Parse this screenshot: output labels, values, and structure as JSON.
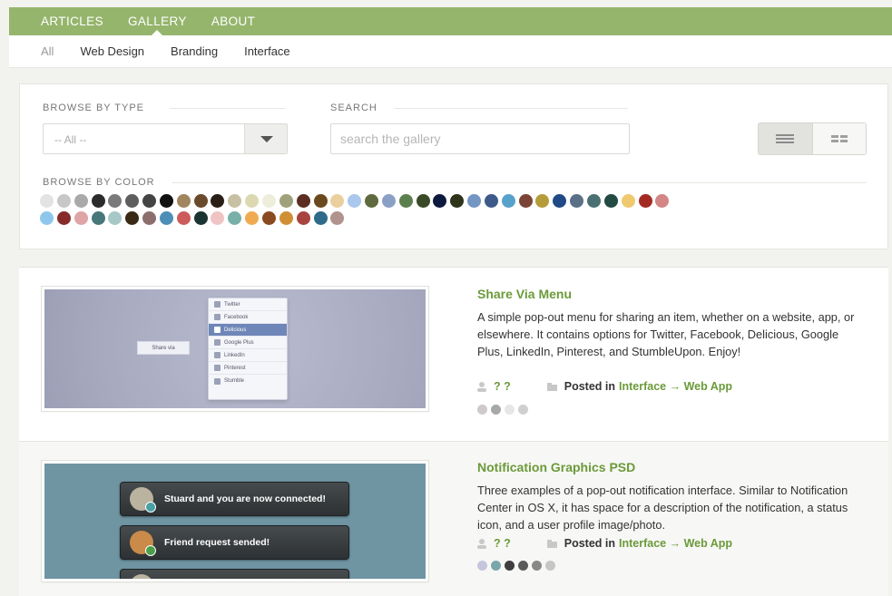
{
  "nav": {
    "items": [
      {
        "label": "ARTICLES"
      },
      {
        "label": "GALLERY"
      },
      {
        "label": "ABOUT"
      }
    ],
    "active": "GALLERY"
  },
  "subnav": {
    "items": [
      {
        "label": "All"
      },
      {
        "label": "Web Design"
      },
      {
        "label": "Branding"
      },
      {
        "label": "Interface"
      }
    ]
  },
  "filters": {
    "browse_type_label": "BROWSE BY TYPE",
    "type_selected": "-- All --",
    "search_label": "SEARCH",
    "search_placeholder": "search the gallery",
    "browse_color_label": "BROWSE BY COLOR",
    "colors_row1": [
      "#e3e3e3",
      "#c7c7c7",
      "#a9a9a9",
      "#2b2b2b",
      "#7a7a7a",
      "#5e5e5e",
      "#444444",
      "#111111",
      "#a0855f",
      "#6b4a2c",
      "#2a1f17",
      "#c8c0a4",
      "#dcd9b2",
      "#eceedb",
      "#9ea17c",
      "#5c2e23",
      "#6a4a1d",
      "#ebcf9d",
      "#aac7ec",
      "#5f6b3e",
      "#8ba0c5",
      "#5b7f4e",
      "#3a4a26",
      "#0d1a3f",
      "#2e341a",
      "#7396c3",
      "#3e5a8a",
      "#57a2cb",
      "#7a4437",
      "#b49c3a",
      "#1f4a86",
      "#5a7086",
      "#4b7071",
      "#234a43",
      "#f0c870",
      "#a32a23",
      "#d48686"
    ],
    "colors_row2": [
      "#8fc7ec",
      "#872b2a",
      "#dea4a6",
      "#46787a",
      "#a6c8c6",
      "#3a2a14",
      "#8c6e6c",
      "#4d8eb8",
      "#cc5b5b",
      "#1a3531",
      "#f0c4c4",
      "#78b0a8",
      "#f0ab52",
      "#8a4a20",
      "#d08f35",
      "#a8443e",
      "#2e6a8a",
      "#b0938c"
    ]
  },
  "items": [
    {
      "title": "Share Via Menu",
      "description": "A simple pop-out menu for sharing an item, whether on a website, app, or elsewhere. It contains options for Twitter, Facebook, Delicious, Google Plus, LinkedIn, Pinterest, and StumbleUpon. Enjoy!",
      "author": "? ?",
      "posted_in": "Posted in",
      "category_link": "Interface → Web App",
      "dots": [
        "#cfc9ca",
        "#a7a9a8",
        "#e6e6e6",
        "#cfcfcf"
      ],
      "thumb": {
        "share_via": "Share via",
        "menu": [
          "Twitter",
          "Facebook",
          "Delicious",
          "Google Plus",
          "LinkedIn",
          "Pinterest",
          "Stumble"
        ],
        "selected": "Delicious"
      }
    },
    {
      "title": "Notification Graphics PSD",
      "description": "Three examples of a pop-out notification interface. Similar to Notification Center in OS X, it has space for a description of the notification, a status icon, and a user profile image/photo.",
      "author": "? ?",
      "posted_in": "Posted in",
      "category_link": "Interface → Web App",
      "dots": [
        "#c5c6dd",
        "#79a7a9",
        "#3e3e3e",
        "#5a5a5a",
        "#888888",
        "#c6c6c6"
      ],
      "thumb": {
        "notifications": [
          "Stuard and you are now connected!",
          "Friend request sended!"
        ]
      }
    }
  ]
}
